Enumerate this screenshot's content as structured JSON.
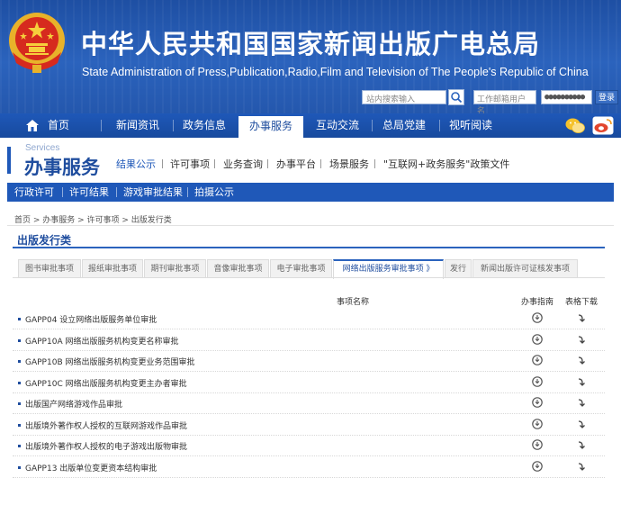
{
  "header": {
    "title": "中华人民共和国国家新闻出版广电总局",
    "subtitle": "State Administration of Press,Publication,Radio,Film and Television of The People's Republic of China",
    "search_placeholder": "站内搜索输入",
    "user_placeholder": "工作邮箱用户名",
    "password_value": "●●●●●●●●●●",
    "login_label": "登录"
  },
  "nav": {
    "items": [
      {
        "label": "首页"
      },
      {
        "label": "新闻资讯"
      },
      {
        "label": "政务信息"
      },
      {
        "label": "办事服务"
      },
      {
        "label": "互动交流"
      },
      {
        "label": "总局党建"
      },
      {
        "label": "视听阅读"
      }
    ],
    "active": "办事服务"
  },
  "services": {
    "en_label": "Services",
    "title": "办事服务",
    "links": [
      {
        "label": "结果公示"
      },
      {
        "label": "许可事项"
      },
      {
        "label": "业务查询"
      },
      {
        "label": "办事平台"
      },
      {
        "label": "场景服务"
      },
      {
        "label": "\"互联网+政务服务\"政策文件"
      }
    ]
  },
  "sub_nav": {
    "items": [
      {
        "label": "行政许可"
      },
      {
        "label": "许可结果"
      },
      {
        "label": "游戏审批结果"
      },
      {
        "label": "拍摄公示"
      }
    ]
  },
  "breadcrumb": "首页 > 办事服务 > 许可事项 > 出版发行类",
  "page_title": "出版发行类",
  "tabs": [
    {
      "label": "图书审批事项"
    },
    {
      "label": "报纸审批事项"
    },
    {
      "label": "期刊审批事项"
    },
    {
      "label": "音像审批事项"
    },
    {
      "label": "电子审批事项"
    },
    {
      "label": "网络出版服务审批事项 》"
    },
    {
      "label": "发行"
    },
    {
      "label": "新闻出版许可证核发事项"
    }
  ],
  "table": {
    "col_name": "事项名称",
    "col_guide": "办事指南",
    "col_download": "表格下载",
    "rows": [
      {
        "name": "GAPP04 设立网络出版服务单位审批"
      },
      {
        "name": "GAPP10A 网络出版服务机构变更名称审批"
      },
      {
        "name": "GAPP10B 网络出版服务机构变更业务范围审批"
      },
      {
        "name": "GAPP10C 网络出版服务机构变更主办者审批"
      },
      {
        "name": "出版国产网络游戏作品审批"
      },
      {
        "name": "出版境外著作权人授权的互联网游戏作品审批"
      },
      {
        "name": "出版境外著作权人授权的电子游戏出版物审批"
      },
      {
        "name": "GAPP13 出版单位变更资本结构审批"
      }
    ]
  },
  "colors": {
    "brand_blue": "#1f58b8",
    "header_blue": "#2b63bd",
    "title_blue": "#1f4d9e"
  }
}
